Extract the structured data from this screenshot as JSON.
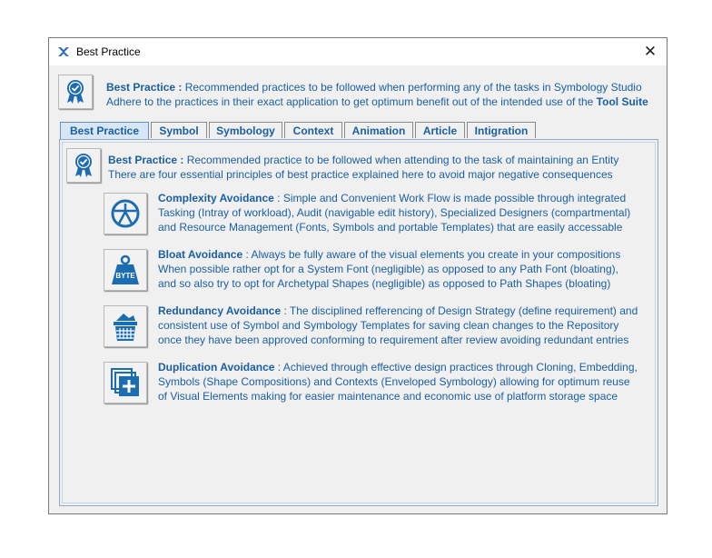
{
  "window": {
    "title": "Best Practice",
    "close_glyph": "✕"
  },
  "header": {
    "heading": "Best Practice :",
    "line1_rest": " Recommended practices to be followed when performing any of the tasks in Symbology Studio",
    "line2_start": "Adhere to the practices in their exact application to get optimum benefit out of the intended use of the ",
    "line2_bold": "Tool Suite",
    "icon": "award-badge-icon"
  },
  "tabs": [
    {
      "label": "Best Practice",
      "active": true
    },
    {
      "label": "Symbol"
    },
    {
      "label": "Symbology"
    },
    {
      "label": "Context"
    },
    {
      "label": "Animation"
    },
    {
      "label": "Article"
    },
    {
      "label": "Intigration"
    }
  ],
  "panel": {
    "heading": "Best Practice :",
    "line1_rest": " Recommended practice to be followed when attending to the task of maintaining an Entity",
    "line2": "There are four essential principles of best practice explained here to avoid major negative consequences",
    "items": [
      {
        "title": "Complexity Avoidance",
        "line1": " : Simple and Convenient Work Flow is made possible through integrated",
        "line2": "Tasking (Intray of workload), Audit (navigable edit history), Specialized Designers (compartmental)",
        "line3": "and Resource Management (Fonts, Symbols and portable Templates) that are easily accessable",
        "icon": "compass-circle-icon"
      },
      {
        "title": "Bloat Avoidance",
        "line1": " : Always be fully aware of the visual elements you create in your compositions",
        "line2": "When possible rather opt for a System Font (negligible) as opposed to any Path Font (bloating),",
        "line3": "and so also try to opt for Archetypal Shapes (negligible) as opposed to Path Shapes (bloating)",
        "icon": "weight-byte-icon",
        "icon_text": "BYTE"
      },
      {
        "title": "Redundancy Avoidance",
        "line1": " : The disciplined refferencing of Design Strategy (define requirement) and",
        "line2": "consistent use of Symbol and Symbology Templates for saving clean changes to the Repository",
        "line3": "once they have been approved conforming to requirement after review avoiding redundant entries",
        "icon": "waste-basket-icon"
      },
      {
        "title": "Duplication Avoidance",
        "line1": " : Achieved through effective design practices through Cloning,  Embedding,",
        "line2": "Symbols (Shape Compositions) and Contexts (Enveloped Symbology) allowing for optimum reuse",
        "line3": "of Visual Elements making for easier maintenance and economic use of platform storage space",
        "icon": "duplicate-add-icon"
      }
    ]
  },
  "colors": {
    "accent": "#1b5fa3",
    "icon_blue": "#1b6cb0"
  }
}
